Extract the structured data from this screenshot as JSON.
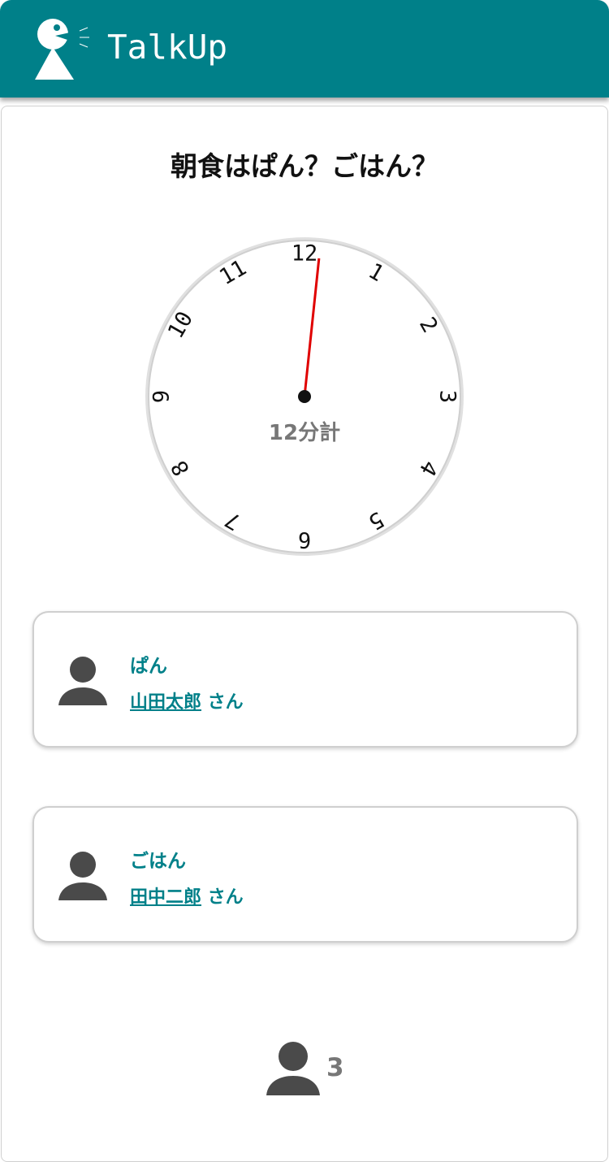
{
  "header": {
    "app_title": "TalkUp",
    "background": "#008089",
    "logo_icon": "speaking-person-icon"
  },
  "topic": {
    "title": "朝食はぱん？ごはん？"
  },
  "clock": {
    "label": "12分計",
    "numbers": [
      "12",
      "1",
      "2",
      "3",
      "4",
      "5",
      "6",
      "7",
      "8",
      "9",
      "10",
      "11"
    ],
    "hand_minutes": 0.2,
    "hand_color": "#e00000"
  },
  "answers": [
    {
      "text": "ぱん",
      "name": "山田太郎",
      "suffix": " さん",
      "icon": "person-icon"
    },
    {
      "text": "ごはん",
      "name": "田中二郎",
      "suffix": " さん",
      "icon": "person-icon"
    }
  ],
  "participants": {
    "count": "3",
    "icon": "person-icon"
  },
  "colors": {
    "accent": "#008089",
    "icon_gray": "#4a4a4a",
    "muted_text": "#777777"
  }
}
